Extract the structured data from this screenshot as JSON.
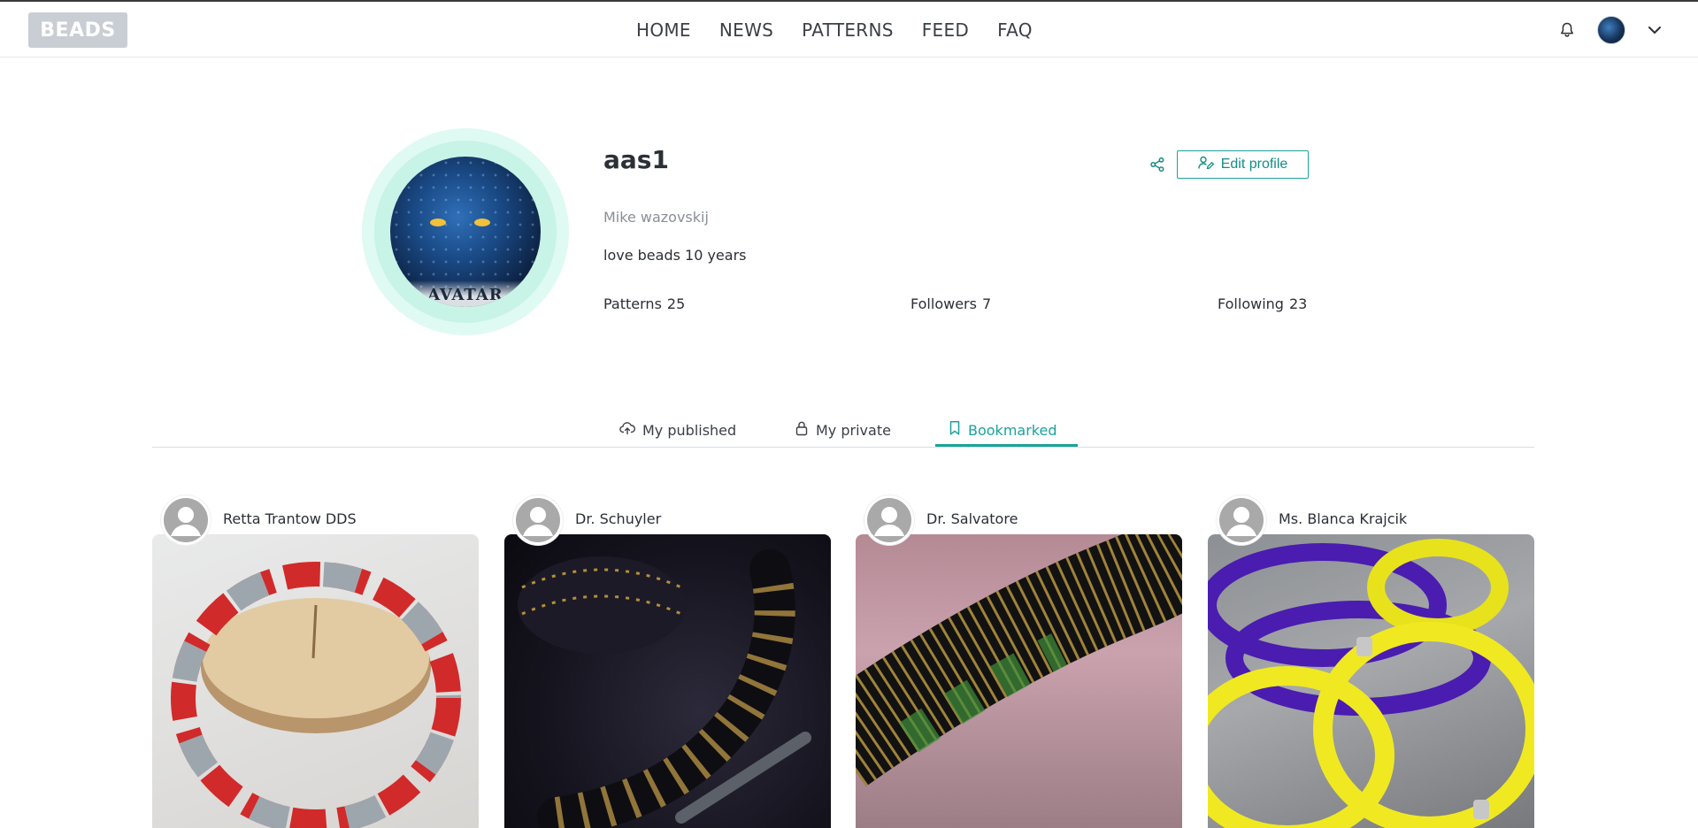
{
  "header": {
    "logo": "BEADS",
    "nav": [
      "HOME",
      "NEWS",
      "PATTERNS",
      "FEED",
      "FAQ"
    ]
  },
  "profile": {
    "username": "aas1",
    "full_name": "Mike wazovskij",
    "bio": "love beads 10 years",
    "avatar_caption": "AVATAR",
    "stats": {
      "patterns_label": "Patterns",
      "patterns_value": "25",
      "followers_label": "Followers",
      "followers_value": "7",
      "following_label": "Following",
      "following_value": "23"
    },
    "edit_label": "Edit profile"
  },
  "tabs": [
    {
      "label": "My published",
      "icon": "cloud-upload-icon",
      "active": false
    },
    {
      "label": "My private",
      "icon": "lock-icon",
      "active": false
    },
    {
      "label": "Bookmarked",
      "icon": "bookmark-icon",
      "active": true
    }
  ],
  "cards": [
    {
      "author": "Retta Trantow DDS"
    },
    {
      "author": "Dr. Schuyler"
    },
    {
      "author": "Dr. Salvatore"
    },
    {
      "author": "Ms. Blanca Krajcik"
    }
  ],
  "colors": {
    "accent": "#1aa39a",
    "logo_bg": "#c9ced4",
    "avatar_ring": "#dffaf2"
  }
}
